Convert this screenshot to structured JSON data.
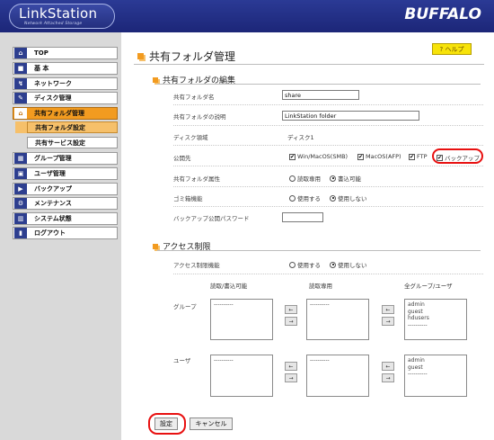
{
  "header": {
    "logo_text": "LinkStation",
    "logo_tagline": "Network Attached Storage",
    "brand": "BUFFALO"
  },
  "sidebar": {
    "items": [
      {
        "label": "TOP"
      },
      {
        "label": "基 本"
      },
      {
        "label": "ネットワーク"
      },
      {
        "label": "ディスク管理"
      },
      {
        "label": "共有フォルダ管理"
      },
      {
        "label": "グループ管理"
      },
      {
        "label": "ユーザ管理"
      },
      {
        "label": "バックアップ"
      },
      {
        "label": "メンテナンス"
      },
      {
        "label": "システム状態"
      },
      {
        "label": "ログアウト"
      }
    ],
    "subitems": [
      {
        "label": "共有フォルダ設定"
      },
      {
        "label": "共有サービス設定"
      }
    ]
  },
  "main": {
    "title": "共有フォルダ管理",
    "help_label": "? ヘルプ",
    "edit_section": {
      "heading": "共有フォルダの編集",
      "folder_name_label": "共有フォルダ名",
      "folder_name_value": "share",
      "description_label": "共有フォルダの説明",
      "description_value": "LinkStation folder",
      "disk_area_label": "ディスク領域",
      "disk_area_value": "ディスク1",
      "publish_label": "公開先",
      "publish_options": [
        "Win/MacOS(SMB)",
        "MacOS(AFP)",
        "FTP",
        "バックアップ"
      ],
      "attr_label": "共有フォルダ属性",
      "attr_options": [
        "読取専用",
        "書込可能"
      ],
      "trash_label": "ゴミ箱機能",
      "trash_options": [
        "使用する",
        "使用しない"
      ],
      "backup_pw_label": "バックアップ公開パスワード",
      "backup_pw_value": ""
    },
    "access_section": {
      "heading": "アクセス制限",
      "access_label": "アクセス制限機能",
      "access_options": [
        "使用する",
        "使用しない"
      ],
      "col_rw": "読取/書込可能",
      "col_ro": "読取専用",
      "col_all": "全グループ/ユーザ",
      "group_label": "グループ",
      "user_label": "ユーザ",
      "group_rw_items": [
        "----------"
      ],
      "group_ro_items": [
        "----------"
      ],
      "group_all_items": [
        "admin",
        "guest",
        "hdusers",
        "----------"
      ],
      "user_rw_items": [
        "----------"
      ],
      "user_ro_items": [
        "----------"
      ],
      "user_all_items": [
        "admin",
        "guest",
        "----------"
      ],
      "arrow_left": "←",
      "arrow_right": "→"
    },
    "buttons": {
      "apply": "設定",
      "cancel": "キャンセル"
    }
  },
  "colors": {
    "header_bg": "#1c2678",
    "accent_orange": "#f29b20",
    "help_yellow": "#f7e30a",
    "highlight_red": "#e81010"
  }
}
